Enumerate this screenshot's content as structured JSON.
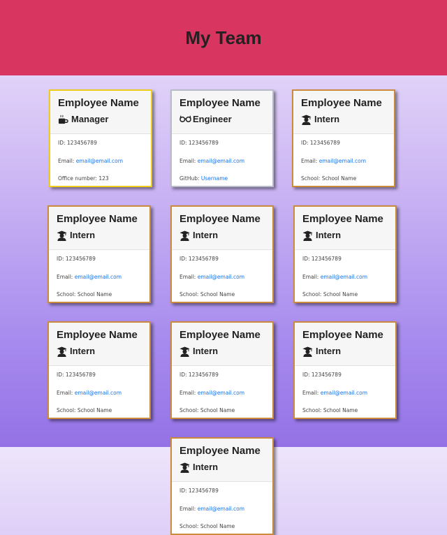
{
  "header": {
    "title": "My Team"
  },
  "colors": {
    "header": "#d83661",
    "manager_border": "#f0cd1d",
    "engineer_border": "#b8bcc8",
    "intern_border": "#cc8a3c",
    "link": "#1a73e8"
  },
  "cards": [
    {
      "name": "Employee Name",
      "role": "Manager",
      "icon": "coffee-icon",
      "id_label": "ID: ",
      "id": "123456789",
      "email_label": "Email: ",
      "email": "email@email.com",
      "extra_label": "Office number: ",
      "extra_value": "123"
    },
    {
      "name": "Employee Name",
      "role": "Engineer",
      "icon": "glasses-icon",
      "id_label": "ID: ",
      "id": "123456789",
      "email_label": "Email: ",
      "email": "email@email.com",
      "extra_label": "GitHub: ",
      "extra_value": "Username"
    },
    {
      "name": "Employee Name",
      "role": "Intern",
      "icon": "graduate-icon",
      "id_label": "ID: ",
      "id": "123456789",
      "email_label": "Email: ",
      "email": "email@email.com",
      "extra_label": "School: ",
      "extra_value": "School Name"
    },
    {
      "name": "Employee Name",
      "role": "Intern",
      "icon": "graduate-icon",
      "id_label": "ID: ",
      "id": "123456789",
      "email_label": "Email: ",
      "email": "email@email.com",
      "extra_label": "School: ",
      "extra_value": "School Name"
    },
    {
      "name": "Employee Name",
      "role": "Intern",
      "icon": "graduate-icon",
      "id_label": "ID: ",
      "id": "123456789",
      "email_label": "Email: ",
      "email": "email@email.com",
      "extra_label": "School: ",
      "extra_value": "School Name"
    },
    {
      "name": "Employee Name",
      "role": "Intern",
      "icon": "graduate-icon",
      "id_label": "ID: ",
      "id": "123456789",
      "email_label": "Email: ",
      "email": "email@email.com",
      "extra_label": "School: ",
      "extra_value": "School Name"
    },
    {
      "name": "Employee Name",
      "role": "Intern",
      "icon": "graduate-icon",
      "id_label": "ID: ",
      "id": "123456789",
      "email_label": "Email: ",
      "email": "email@email.com",
      "extra_label": "School: ",
      "extra_value": "School Name"
    },
    {
      "name": "Employee Name",
      "role": "Intern",
      "icon": "graduate-icon",
      "id_label": "ID: ",
      "id": "123456789",
      "email_label": "Email: ",
      "email": "email@email.com",
      "extra_label": "School: ",
      "extra_value": "School Name"
    },
    {
      "name": "Employee Name",
      "role": "Intern",
      "icon": "graduate-icon",
      "id_label": "ID: ",
      "id": "123456789",
      "email_label": "Email: ",
      "email": "email@email.com",
      "extra_label": "School: ",
      "extra_value": "School Name"
    },
    {
      "name": "Employee Name",
      "role": "Intern",
      "icon": "graduate-icon",
      "id_label": "ID: ",
      "id": "123456789",
      "email_label": "Email: ",
      "email": "email@email.com",
      "extra_label": "School: ",
      "extra_value": "School Name"
    }
  ]
}
